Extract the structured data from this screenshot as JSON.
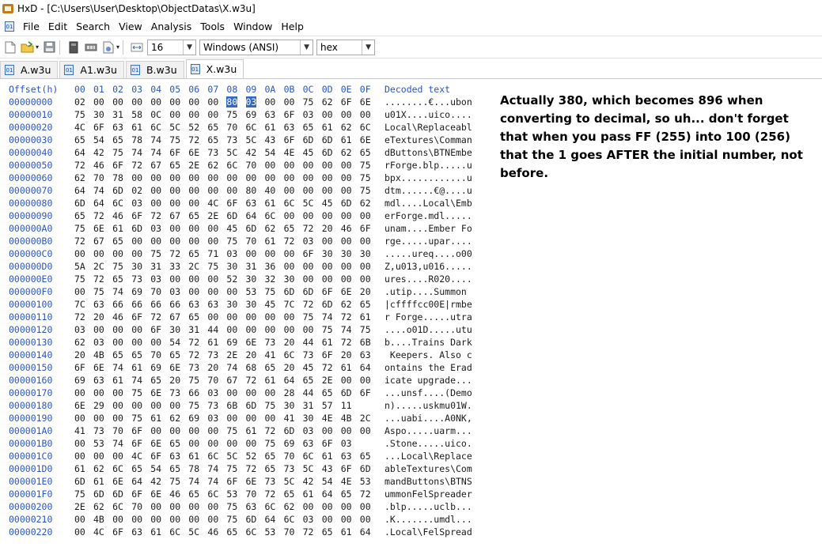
{
  "window": {
    "title": "HxD - [C:\\Users\\User\\Desktop\\ObjectDatas\\X.w3u]"
  },
  "menu": [
    "File",
    "Edit",
    "Search",
    "View",
    "Analysis",
    "Tools",
    "Window",
    "Help"
  ],
  "toolbar": {
    "icons": [
      "new-file-icon",
      "open-folder-icon",
      "save-icon",
      "disk-icon",
      "ram-icon",
      "file-properties-icon",
      "columns-width-icon"
    ],
    "bytes_per_row": "16",
    "charset": "Windows (ANSI)",
    "offset_base": "hex"
  },
  "tabs": [
    {
      "label": "A.w3u",
      "active": false
    },
    {
      "label": "A1.w3u",
      "active": false
    },
    {
      "label": "B.w3u",
      "active": false
    },
    {
      "label": "X.w3u",
      "active": true
    }
  ],
  "hex": {
    "offset_header": "Offset(h)",
    "column_headers": [
      "00",
      "01",
      "02",
      "03",
      "04",
      "05",
      "06",
      "07",
      "08",
      "09",
      "0A",
      "0B",
      "0C",
      "0D",
      "0E",
      "0F"
    ],
    "decoded_header": "Decoded text",
    "selected": {
      "row": 0,
      "bytes": [
        8,
        9
      ]
    },
    "rows": [
      {
        "offset": "00000000",
        "bytes": [
          "02",
          "00",
          "00",
          "00",
          "00",
          "00",
          "00",
          "00",
          "80",
          "03",
          "00",
          "00",
          "75",
          "62",
          "6F",
          "6E"
        ],
        "decoded": "........€...ubon"
      },
      {
        "offset": "00000010",
        "bytes": [
          "75",
          "30",
          "31",
          "58",
          "0C",
          "00",
          "00",
          "00",
          "75",
          "69",
          "63",
          "6F",
          "03",
          "00",
          "00",
          "00"
        ],
        "decoded": "u01X....uico...."
      },
      {
        "offset": "00000020",
        "bytes": [
          "4C",
          "6F",
          "63",
          "61",
          "6C",
          "5C",
          "52",
          "65",
          "70",
          "6C",
          "61",
          "63",
          "65",
          "61",
          "62",
          "6C"
        ],
        "decoded": "Local\\Replaceabl"
      },
      {
        "offset": "00000030",
        "bytes": [
          "65",
          "54",
          "65",
          "78",
          "74",
          "75",
          "72",
          "65",
          "73",
          "5C",
          "43",
          "6F",
          "6D",
          "6D",
          "61",
          "6E"
        ],
        "decoded": "eTextures\\Comman"
      },
      {
        "offset": "00000040",
        "bytes": [
          "64",
          "42",
          "75",
          "74",
          "74",
          "6F",
          "6E",
          "73",
          "5C",
          "42",
          "54",
          "4E",
          "45",
          "6D",
          "62",
          "65"
        ],
        "decoded": "dButtons\\BTNEmbe"
      },
      {
        "offset": "00000050",
        "bytes": [
          "72",
          "46",
          "6F",
          "72",
          "67",
          "65",
          "2E",
          "62",
          "6C",
          "70",
          "00",
          "00",
          "00",
          "00",
          "00",
          "75"
        ],
        "decoded": "rForge.blp.....u"
      },
      {
        "offset": "00000060",
        "bytes": [
          "62",
          "70",
          "78",
          "00",
          "00",
          "00",
          "00",
          "00",
          "00",
          "00",
          "00",
          "00",
          "00",
          "00",
          "00",
          "75"
        ],
        "decoded": "bpx............u"
      },
      {
        "offset": "00000070",
        "bytes": [
          "64",
          "74",
          "6D",
          "02",
          "00",
          "00",
          "00",
          "00",
          "00",
          "80",
          "40",
          "00",
          "00",
          "00",
          "00",
          "75"
        ],
        "decoded": "dtm......€@....u"
      },
      {
        "offset": "00000080",
        "bytes": [
          "6D",
          "64",
          "6C",
          "03",
          "00",
          "00",
          "00",
          "4C",
          "6F",
          "63",
          "61",
          "6C",
          "5C",
          "45",
          "6D",
          "62"
        ],
        "decoded": "mdl....Local\\Emb"
      },
      {
        "offset": "00000090",
        "bytes": [
          "65",
          "72",
          "46",
          "6F",
          "72",
          "67",
          "65",
          "2E",
          "6D",
          "64",
          "6C",
          "00",
          "00",
          "00",
          "00",
          "00"
        ],
        "decoded": "erForge.mdl....."
      },
      {
        "offset": "000000A0",
        "bytes": [
          "75",
          "6E",
          "61",
          "6D",
          "03",
          "00",
          "00",
          "00",
          "45",
          "6D",
          "62",
          "65",
          "72",
          "20",
          "46",
          "6F"
        ],
        "decoded": "unam....Ember Fo"
      },
      {
        "offset": "000000B0",
        "bytes": [
          "72",
          "67",
          "65",
          "00",
          "00",
          "00",
          "00",
          "00",
          "75",
          "70",
          "61",
          "72",
          "03",
          "00",
          "00",
          "00"
        ],
        "decoded": "rge.....upar...."
      },
      {
        "offset": "000000C0",
        "bytes": [
          "00",
          "00",
          "00",
          "00",
          "75",
          "72",
          "65",
          "71",
          "03",
          "00",
          "00",
          "00",
          "6F",
          "30",
          "30",
          "30"
        ],
        "decoded": ".....ureq....o00"
      },
      {
        "offset": "000000D0",
        "bytes": [
          "5A",
          "2C",
          "75",
          "30",
          "31",
          "33",
          "2C",
          "75",
          "30",
          "31",
          "36",
          "00",
          "00",
          "00",
          "00",
          "00"
        ],
        "decoded": "Z,u013,u016....."
      },
      {
        "offset": "000000E0",
        "bytes": [
          "75",
          "72",
          "65",
          "73",
          "03",
          "00",
          "00",
          "00",
          "52",
          "30",
          "32",
          "30",
          "00",
          "00",
          "00",
          "00"
        ],
        "decoded": "ures....R020...."
      },
      {
        "offset": "000000F0",
        "bytes": [
          "00",
          "75",
          "74",
          "69",
          "70",
          "03",
          "00",
          "00",
          "00",
          "53",
          "75",
          "6D",
          "6D",
          "6F",
          "6E",
          "20"
        ],
        "decoded": ".utip....Summon "
      },
      {
        "offset": "00000100",
        "bytes": [
          "7C",
          "63",
          "66",
          "66",
          "66",
          "66",
          "63",
          "63",
          "30",
          "30",
          "45",
          "7C",
          "72",
          "6D",
          "62",
          "65"
        ],
        "decoded": "|cffffcc00E|rmbe"
      },
      {
        "offset": "00000110",
        "bytes": [
          "72",
          "20",
          "46",
          "6F",
          "72",
          "67",
          "65",
          "00",
          "00",
          "00",
          "00",
          "00",
          "75",
          "74",
          "72",
          "61"
        ],
        "decoded": "r Forge.....utra"
      },
      {
        "offset": "00000120",
        "bytes": [
          "03",
          "00",
          "00",
          "00",
          "6F",
          "30",
          "31",
          "44",
          "00",
          "00",
          "00",
          "00",
          "00",
          "75",
          "74",
          "75"
        ],
        "decoded": "....o01D.....utu"
      },
      {
        "offset": "00000130",
        "bytes": [
          "62",
          "03",
          "00",
          "00",
          "00",
          "54",
          "72",
          "61",
          "69",
          "6E",
          "73",
          "20",
          "44",
          "61",
          "72",
          "6B"
        ],
        "decoded": "b....Trains Dark"
      },
      {
        "offset": "00000140",
        "bytes": [
          "20",
          "4B",
          "65",
          "65",
          "70",
          "65",
          "72",
          "73",
          "2E",
          "20",
          "41",
          "6C",
          "73",
          "6F",
          "20",
          "63"
        ],
        "decoded": " Keepers. Also c"
      },
      {
        "offset": "00000150",
        "bytes": [
          "6F",
          "6E",
          "74",
          "61",
          "69",
          "6E",
          "73",
          "20",
          "74",
          "68",
          "65",
          "20",
          "45",
          "72",
          "61",
          "64"
        ],
        "decoded": "ontains the Erad"
      },
      {
        "offset": "00000160",
        "bytes": [
          "69",
          "63",
          "61",
          "74",
          "65",
          "20",
          "75",
          "70",
          "67",
          "72",
          "61",
          "64",
          "65",
          "2E",
          "00",
          "00"
        ],
        "decoded": "icate upgrade..."
      },
      {
        "offset": "00000170",
        "bytes": [
          "00",
          "00",
          "00",
          "75",
          "6E",
          "73",
          "66",
          "03",
          "00",
          "00",
          "00",
          "28",
          "44",
          "65",
          "6D",
          "6F"
        ],
        "decoded": "...unsf....(Demo"
      },
      {
        "offset": "00000180",
        "bytes": [
          "6E",
          "29",
          "00",
          "00",
          "00",
          "00",
          "75",
          "73",
          "6B",
          "6D",
          "75",
          "30",
          "31",
          "57",
          "11"
        ],
        "decoded": "n).....uskmu01W."
      },
      {
        "offset": "00000190",
        "bytes": [
          "00",
          "00",
          "00",
          "75",
          "61",
          "62",
          "69",
          "03",
          "00",
          "00",
          "00",
          "41",
          "30",
          "4E",
          "4B",
          "2C"
        ],
        "decoded": "...uabi....A0NK,"
      },
      {
        "offset": "000001A0",
        "bytes": [
          "41",
          "73",
          "70",
          "6F",
          "00",
          "00",
          "00",
          "00",
          "75",
          "61",
          "72",
          "6D",
          "03",
          "00",
          "00",
          "00"
        ],
        "decoded": "Aspo.....uarm..."
      },
      {
        "offset": "000001B0",
        "bytes": [
          "00",
          "53",
          "74",
          "6F",
          "6E",
          "65",
          "00",
          "00",
          "00",
          "00",
          "75",
          "69",
          "63",
          "6F",
          "03"
        ],
        "decoded": ".Stone.....uico."
      },
      {
        "offset": "000001C0",
        "bytes": [
          "00",
          "00",
          "00",
          "4C",
          "6F",
          "63",
          "61",
          "6C",
          "5C",
          "52",
          "65",
          "70",
          "6C",
          "61",
          "63",
          "65"
        ],
        "decoded": "...Local\\Replace"
      },
      {
        "offset": "000001D0",
        "bytes": [
          "61",
          "62",
          "6C",
          "65",
          "54",
          "65",
          "78",
          "74",
          "75",
          "72",
          "65",
          "73",
          "5C",
          "43",
          "6F",
          "6D"
        ],
        "decoded": "ableTextures\\Com"
      },
      {
        "offset": "000001E0",
        "bytes": [
          "6D",
          "61",
          "6E",
          "64",
          "42",
          "75",
          "74",
          "74",
          "6F",
          "6E",
          "73",
          "5C",
          "42",
          "54",
          "4E",
          "53"
        ],
        "decoded": "mandButtons\\BTNS"
      },
      {
        "offset": "000001F0",
        "bytes": [
          "75",
          "6D",
          "6D",
          "6F",
          "6E",
          "46",
          "65",
          "6C",
          "53",
          "70",
          "72",
          "65",
          "61",
          "64",
          "65",
          "72"
        ],
        "decoded": "ummonFelSpreader"
      },
      {
        "offset": "00000200",
        "bytes": [
          "2E",
          "62",
          "6C",
          "70",
          "00",
          "00",
          "00",
          "00",
          "75",
          "63",
          "6C",
          "62",
          "00",
          "00",
          "00",
          "00"
        ],
        "decoded": ".blp.....uclb..."
      },
      {
        "offset": "00000210",
        "bytes": [
          "00",
          "4B",
          "00",
          "00",
          "00",
          "00",
          "00",
          "00",
          "75",
          "6D",
          "64",
          "6C",
          "03",
          "00",
          "00",
          "00"
        ],
        "decoded": ".K.......umdl..."
      },
      {
        "offset": "00000220",
        "bytes": [
          "00",
          "4C",
          "6F",
          "63",
          "61",
          "6C",
          "5C",
          "46",
          "65",
          "6C",
          "53",
          "70",
          "72",
          "65",
          "61",
          "64"
        ],
        "decoded": ".Local\\FelSpread"
      }
    ]
  },
  "annotation": "Actually 380, which becomes 896 when converting to decimal, so uh... don't forget that when you pass FF (255) into 100 (256) that the 1 goes AFTER the initial number, not before."
}
